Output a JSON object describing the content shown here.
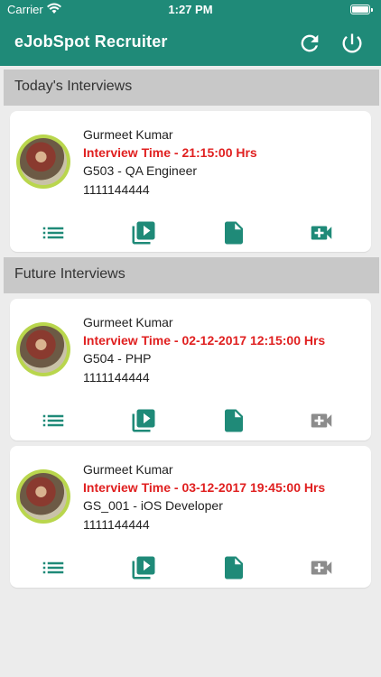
{
  "status_bar": {
    "carrier": "Carrier",
    "time": "1:27 PM"
  },
  "app": {
    "title": "eJobSpot Recruiter"
  },
  "colors": {
    "primary": "#1f8a78",
    "accent_red": "#e02020",
    "disabled_grey": "#8c8c8c"
  },
  "sections": {
    "today": {
      "title": "Today's Interviews",
      "items": [
        {
          "name": "Gurmeet Kumar",
          "interview_time": "Interview Time - 21:15:00 Hrs",
          "position": "G503 - QA Engineer",
          "phone": "1111144444",
          "video_enabled": true
        }
      ]
    },
    "future": {
      "title": "Future Interviews",
      "items": [
        {
          "name": "Gurmeet Kumar",
          "interview_time": "Interview Time - 02-12-2017 12:15:00 Hrs",
          "position": "G504 - PHP",
          "phone": "1111144444",
          "video_enabled": false
        },
        {
          "name": "Gurmeet Kumar",
          "interview_time": "Interview Time - 03-12-2017 19:45:00 Hrs",
          "position": "GS_001 - iOS Developer",
          "phone": "1111144444",
          "video_enabled": false
        }
      ]
    }
  },
  "icons": [
    "wifi-icon",
    "battery-icon",
    "refresh-icon",
    "power-icon",
    "list-icon",
    "video-library-icon",
    "document-icon",
    "add-video-call-icon"
  ]
}
